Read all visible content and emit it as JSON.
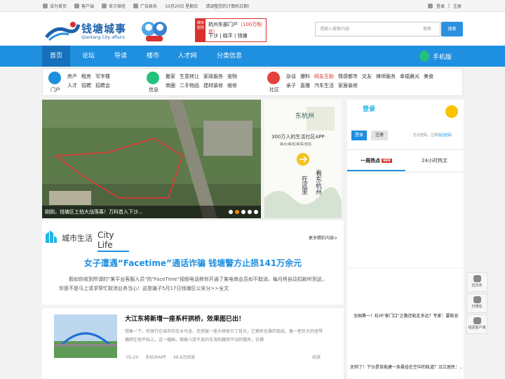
{
  "topbar": {
    "left": [
      "设为首页",
      "客户端",
      "官方微信",
      "广告联系",
      "10月20日 星期日",
      "请调整您的计算机日期!"
    ],
    "right": [
      "登录",
      "|",
      "注册"
    ]
  },
  "brand": {
    "name": "钱塘城事",
    "sub": "Qiantang City affairs"
  },
  "portal": {
    "tag": "媒体矩阵",
    "title": "杭州东部门户",
    "fans": "（100万粉丝）",
    "links": "下沙 | 临平 | 钱塘"
  },
  "search": {
    "placeholder": "请输入搜索内容",
    "select": "搜索",
    "button": "搜索"
  },
  "nav": {
    "items": [
      "首页",
      "论坛",
      "导读",
      "楼市",
      "人才网",
      "分类信息"
    ],
    "mobile": "手机版"
  },
  "categories": [
    {
      "name": "门户",
      "links": [
        "房产",
        "租房",
        "写字楼",
        "人才",
        "招聘",
        "招聘会"
      ]
    },
    {
      "name": "信息",
      "links": [
        "搬家",
        "生意转让",
        "家政服务",
        "宠物",
        "商圈",
        "二手物品",
        "建材装修",
        "维修"
      ]
    },
    {
      "name": "社区",
      "links": [
        "杂谈",
        "爆料",
        "网友互助",
        "情感都市",
        "交友",
        "律师服务",
        "幸福晨光",
        "美食",
        "亲子",
        "直播",
        "汽车生活",
        "家居装修"
      ]
    }
  ],
  "photo": {
    "caption": "刚刚，钱塘区土拍大战落幕！万科首入下沙..."
  },
  "ad": {
    "title": "300万人的生活社区APP",
    "sub": "美女/美容/美事/自拍",
    "logo": "东杭州",
    "line1": "看东杭州",
    "line2": "在这里"
  },
  "login": {
    "title": "登录",
    "login_btn": "登录",
    "reg_btn": "注册",
    "forgot": "忘记密码，立即",
    "forgot_link": "找回密码"
  },
  "hot": {
    "tab1": "一周热点",
    "new": "NEW",
    "tab2": "24小时热文"
  },
  "side": {
    "news1": "全国第一！杭州\"家门口\"之路还能走多远？专家：要既安�...",
    "news2": "太帅了！下沙是否能建一条悬挂在空中的轨道？沿江居民：..."
  },
  "section": {
    "cn": "城市生活",
    "en": "City Life",
    "more": "更多精彩内容>"
  },
  "headline": "女子遭遇“Facetime”通话诈骗 钱塘警方止损141万余元",
  "lead": "假如你收到所谓的\"某平台客服人员\"的\"FaceTime\"视频电话称你开通了某电商会员如不取消，每月将自动扣款听到这，你是不是马上请求帮忙取消业务当心！这是骗子5月17日钱塘区公安分>>全文",
  "article": {
    "title": "大江东将新增一座系杆拱桥，效果图已出！",
    "excerpt": "想象一下，你穿行在城市的车水马龙，忽然被一座大桥吸引了目光，它拥有优雅的弧线，像一把巨大的竖琴横跨在地平线上。这一幅画，随着川流不息的车海和巍然不动的楼房，仿佛",
    "date": "05-20",
    "source": "东杭州APP",
    "views": "49.6万阅读",
    "reads": "阅读"
  },
  "float": [
    "找法务",
    "扫微信",
    "组团客户端"
  ]
}
